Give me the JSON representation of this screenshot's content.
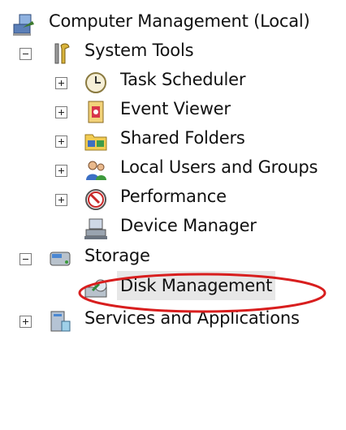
{
  "tree": {
    "root": {
      "label": "Computer Management (Local)",
      "icon": "computer-management-icon"
    },
    "system_tools": {
      "label": "System Tools",
      "icon": "tools-icon",
      "expander": "minus",
      "children": [
        {
          "label": "Task Scheduler",
          "icon": "clock-icon",
          "expander": "plus"
        },
        {
          "label": "Event Viewer",
          "icon": "event-viewer-icon",
          "expander": "plus"
        },
        {
          "label": "Shared Folders",
          "icon": "shared-folders-icon",
          "expander": "plus"
        },
        {
          "label": "Local Users and Groups",
          "icon": "users-icon",
          "expander": "plus"
        },
        {
          "label": "Performance",
          "icon": "performance-icon",
          "expander": "plus"
        },
        {
          "label": "Device Manager",
          "icon": "device-manager-icon",
          "expander": "none"
        }
      ]
    },
    "storage": {
      "label": "Storage",
      "icon": "storage-icon",
      "expander": "minus",
      "children": [
        {
          "label": "Disk Management",
          "icon": "disk-icon",
          "selected": true
        }
      ]
    },
    "services": {
      "label": "Services and Applications",
      "icon": "services-icon",
      "expander": "plus"
    }
  },
  "colors": {
    "highlight_circle": "#d81e1e",
    "selection_bg": "#e7e7e7"
  }
}
